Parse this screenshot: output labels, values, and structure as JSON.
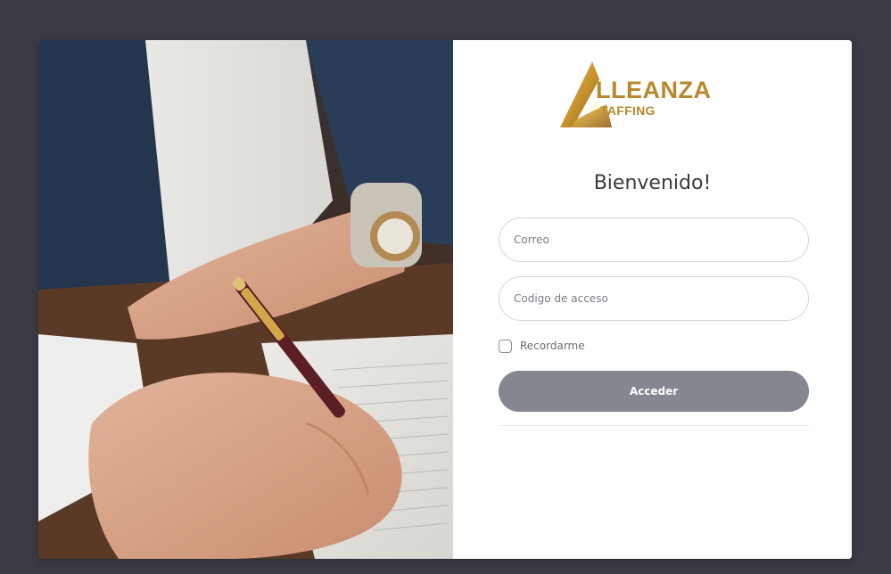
{
  "brand": {
    "wordmark": "LLEANZA",
    "subtitle": "TAFFING",
    "color": "#b8892c",
    "icon": "triangle-a-logo-icon"
  },
  "hero_image": {
    "description_icon": "person-signing-document-photo"
  },
  "login": {
    "title": "Bienvenido!",
    "email_placeholder": "Correo",
    "code_placeholder": "Codigo de acceso",
    "remember_label": "Recordarme",
    "remember_checked": false,
    "submit_label": "Acceder",
    "submit_color": "#848690"
  },
  "colors": {
    "background": "#3a3b44",
    "card": "#ffffff"
  }
}
